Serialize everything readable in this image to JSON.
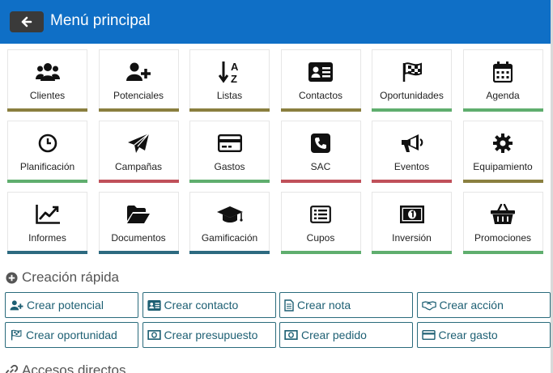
{
  "header": {
    "title": "Menú principal",
    "back_icon": "arrow-left-icon",
    "bg": "#0f6fc6"
  },
  "tiles": [
    {
      "label": "Clientes",
      "icon": "users-icon",
      "bar": "#8a7f3f"
    },
    {
      "label": "Potenciales",
      "icon": "user-plus-icon",
      "bar": "#8a7f3f"
    },
    {
      "label": "Listas",
      "icon": "sort-alpha-down-icon",
      "bar": "#8a7f3f"
    },
    {
      "label": "Contactos",
      "icon": "address-card-icon",
      "bar": "#8a7f3f"
    },
    {
      "label": "Oportunidades",
      "icon": "flag-checkered-icon",
      "bar": "#5fae6e"
    },
    {
      "label": "Agenda",
      "icon": "calendar-icon",
      "bar": "#5fae6e"
    },
    {
      "label": "Planificación",
      "icon": "clock-icon",
      "bar": "#5fae6e"
    },
    {
      "label": "Campañas",
      "icon": "paper-plane-icon",
      "bar": "#c0505a"
    },
    {
      "label": "Gastos",
      "icon": "credit-card-icon",
      "bar": "#5fae6e"
    },
    {
      "label": "SAC",
      "icon": "phone-square-icon",
      "bar": "#c0505a"
    },
    {
      "label": "Eventos",
      "icon": "bullhorn-icon",
      "bar": "#c0505a"
    },
    {
      "label": "Equipamiento",
      "icon": "cog-icon",
      "bar": "#8a7f3f"
    },
    {
      "label": "Informes",
      "icon": "chart-line-icon",
      "bar": "#2d6a80"
    },
    {
      "label": "Documentos",
      "icon": "folder-open-icon",
      "bar": "#2d6a80"
    },
    {
      "label": "Gamificación",
      "icon": "graduation-cap-icon",
      "bar": "#2d6a80"
    },
    {
      "label": "Cupos",
      "icon": "list-alt-icon",
      "bar": "#5fae6e"
    },
    {
      "label": "Inversión",
      "icon": "money-bill-icon",
      "bar": "#5fae6e"
    },
    {
      "label": "Promociones",
      "icon": "shopping-basket-icon",
      "bar": "#5fae6e"
    }
  ],
  "quick": {
    "title": "Creación rápida",
    "icon": "plus-circle-icon",
    "buttons": [
      {
        "label": "Crear potencial",
        "icon": "user-plus-icon"
      },
      {
        "label": "Crear contacto",
        "icon": "address-card-icon"
      },
      {
        "label": "Crear nota",
        "icon": "file-text-icon"
      },
      {
        "label": "Crear acción",
        "icon": "handshake-icon"
      },
      {
        "label": "Crear oportunidad",
        "icon": "flag-checkered-icon"
      },
      {
        "label": "Crear presupuesto",
        "icon": "money-bill-icon"
      },
      {
        "label": "Crear pedido",
        "icon": "money-bill-icon"
      },
      {
        "label": "Crear gasto",
        "icon": "credit-card-icon"
      }
    ]
  },
  "shortcuts": {
    "title": "Accesos directos",
    "icon": "link-icon"
  }
}
